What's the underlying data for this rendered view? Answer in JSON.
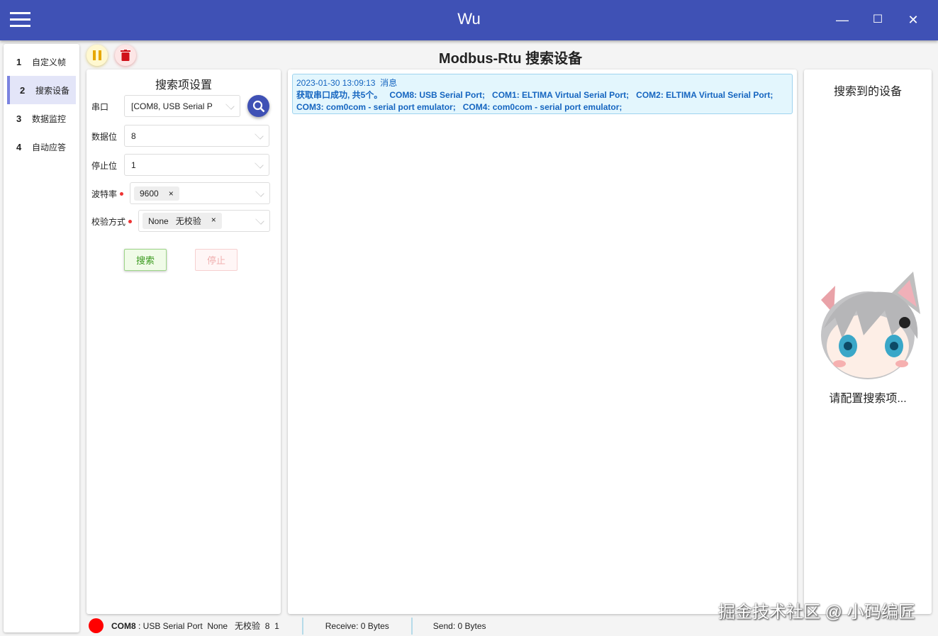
{
  "window": {
    "title": "Wu",
    "minimize": "—",
    "maximize": "☐",
    "close": "✕"
  },
  "nav": {
    "items": [
      {
        "num": "1",
        "label": "自定义帧"
      },
      {
        "num": "2",
        "label": "搜索设备"
      },
      {
        "num": "3",
        "label": "数据监控"
      },
      {
        "num": "4",
        "label": "自动应答"
      }
    ]
  },
  "page": {
    "title": "Modbus-Rtu 搜索设备"
  },
  "settings": {
    "title": "搜索项设置",
    "port": {
      "label": "串口",
      "value": "[COM8, USB Serial P"
    },
    "databits": {
      "label": "数据位",
      "value": "8"
    },
    "stopbits": {
      "label": "停止位",
      "value": "1"
    },
    "baud": {
      "label": "波特率",
      "value": "9600",
      "remove": "×"
    },
    "parity": {
      "label": "校验方式",
      "value": "None   无校验",
      "remove": "×"
    },
    "search_label": "搜索",
    "stop_label": "停止"
  },
  "log": {
    "time": "2023-01-30 13:09:13",
    "kind": "消息",
    "text": "获取串口成功, 共5个。   COM8: USB Serial Port;   COM1: ELTIMA Virtual Serial Port;   COM2: ELTIMA Virtual Serial Port;   COM3: com0com - serial port emulator;   COM4: com0com - serial port emulator;"
  },
  "found": {
    "title": "搜索到的设备",
    "hint": "请配置搜索项..."
  },
  "status": {
    "port": "COM8",
    "desc": " : USB Serial Port  None   无校验  8  1",
    "receive": "Receive: 0 Bytes",
    "send": "Send: 0 Bytes",
    "indicator_color": "#ff0000"
  },
  "watermark": "掘金技术社区 @ 小码编匠"
}
